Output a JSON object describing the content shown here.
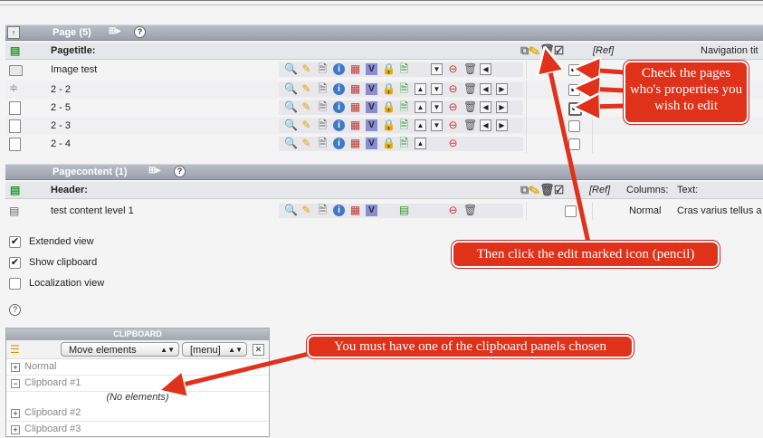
{
  "page_section": {
    "title": "Page (5)",
    "header_label": "Pagetitle:",
    "ref_label": "[Ref]",
    "extra_header": "Navigation tit",
    "rows": [
      {
        "title": "Image test",
        "checked": true
      },
      {
        "title": "2 - 2",
        "checked": true
      },
      {
        "title": "2 - 5",
        "checked": true
      },
      {
        "title": "2 - 3",
        "checked": false
      },
      {
        "title": "2 - 4",
        "checked": false
      }
    ]
  },
  "content_section": {
    "title": "Pagecontent (1)",
    "header_label": "Header:",
    "ref_label": "[Ref]",
    "columns_label": "Columns:",
    "text_label": "Text:",
    "rows": [
      {
        "title": "test content level 1",
        "column": "Normal",
        "text": "Cras varius tellus a"
      }
    ]
  },
  "options": {
    "extended_view": {
      "label": "Extended view",
      "checked": true
    },
    "show_clipboard": {
      "label": "Show clipboard",
      "checked": true
    },
    "localization_view": {
      "label": "Localization view",
      "checked": false
    }
  },
  "clipboard": {
    "title": "CLIPBOARD",
    "mode_select": "Move elements",
    "menu_select": "[menu]",
    "pads": [
      {
        "name": "Normal",
        "expanded": false
      },
      {
        "name": "Clipboard #1",
        "expanded": true,
        "empty_text": "(No elements)"
      },
      {
        "name": "Clipboard #2",
        "expanded": false
      },
      {
        "name": "Clipboard #3",
        "expanded": false
      }
    ]
  },
  "callouts": {
    "check_pages": "Check the pages who's properties you wish to edit",
    "click_edit": "Then click the edit marked icon (pencil)",
    "clipboard_note": "You must have one of the clipboard panels chosen"
  },
  "colors": {
    "callout": "#e0311b",
    "header_bar": "#a3a7b2"
  }
}
